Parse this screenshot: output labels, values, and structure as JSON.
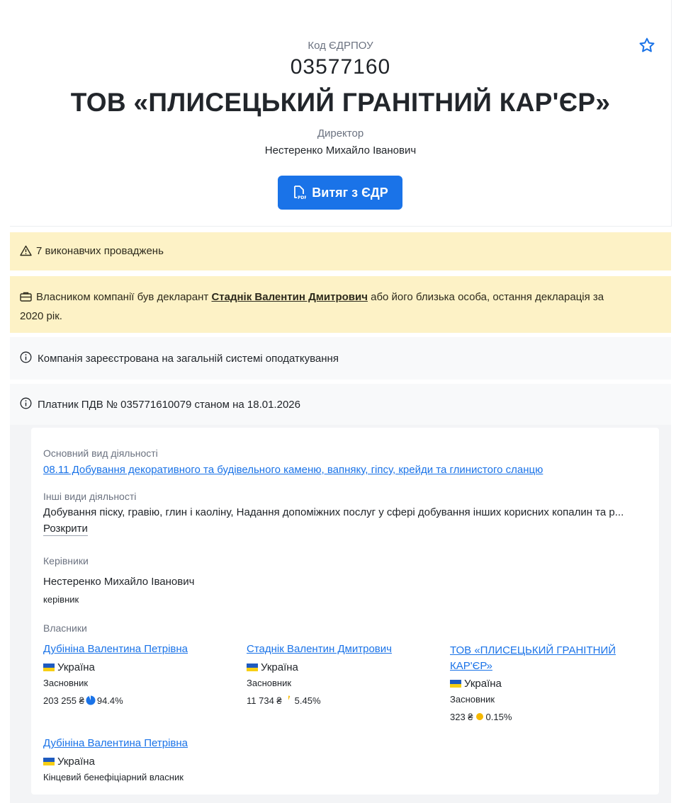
{
  "header": {
    "code_label": "Код ЄДРПОУ",
    "code_value": "03577160",
    "company_name": "ТОВ «ПЛИСЕЦЬКИЙ ГРАНІТНИЙ КАР'ЄР»",
    "role_label": "Директор",
    "director_name": "Нестеренко Михайло Іванович",
    "extract_button": "Витяг з ЄДР",
    "favorite_icon": "star-icon"
  },
  "alerts": {
    "enforcement": "7 виконавчих проваджень",
    "declarant_prefix": "Власником компанії був декларант",
    "declarant_name": "Стаднік Валентин Дмитрович",
    "declarant_suffix_1": "або його близька особа, остання декларація за",
    "declarant_suffix_2": "2020 рік."
  },
  "info": {
    "tax_system": "Компанія зареєстрована на загальній системі оподаткування",
    "vat": "Платник ПДВ № 035771610079 станом на 18.01.2026"
  },
  "details": {
    "main_activity_label": "Основний вид діяльності",
    "main_activity": "08.11 Добування декоративного та будівельного каменю, вапняку, гіпсу, крейди та глинистого сланцю",
    "other_activities_label": "Інші види діяльності",
    "other_activities": "Добування піску, гравію, глин і каоліну, Надання допоміжних послуг у сфері добування інших корисних копалин та р...",
    "expand_label": "Розкрити",
    "managers_label": "Керівники",
    "manager_name": "Нестеренко Михайло Іванович",
    "manager_role": "керівник",
    "owners_label": "Власники",
    "owners": [
      {
        "name": "Дубініна Валентина Петрівна",
        "country": "Україна",
        "role": "Засновник",
        "amount": "203 255 ₴",
        "share": "94.4%",
        "share_color": "#1a73e8",
        "share_fraction": 0.944
      },
      {
        "name": "Стаднік Валентин Дмитрович",
        "country": "Україна",
        "role": "Засновник",
        "amount": "11 734 ₴",
        "share": "5.45%",
        "share_color": "#f5b800",
        "share_fraction": 0.0545
      },
      {
        "name_line1": "ТОВ «ПЛИСЕЦЬКИЙ ГРАНІТНИЙ",
        "name_line2": "КАР'ЄР»",
        "country": "Україна",
        "role": "Засновник",
        "amount": "323 ₴",
        "share": "0.15%",
        "share_color": "#f5b800",
        "share_fraction": 0.0015
      },
      {
        "name": "Дубініна Валентина Петрівна",
        "country": "Україна",
        "role": "Кінцевий бенефіціарний власник"
      }
    ]
  }
}
